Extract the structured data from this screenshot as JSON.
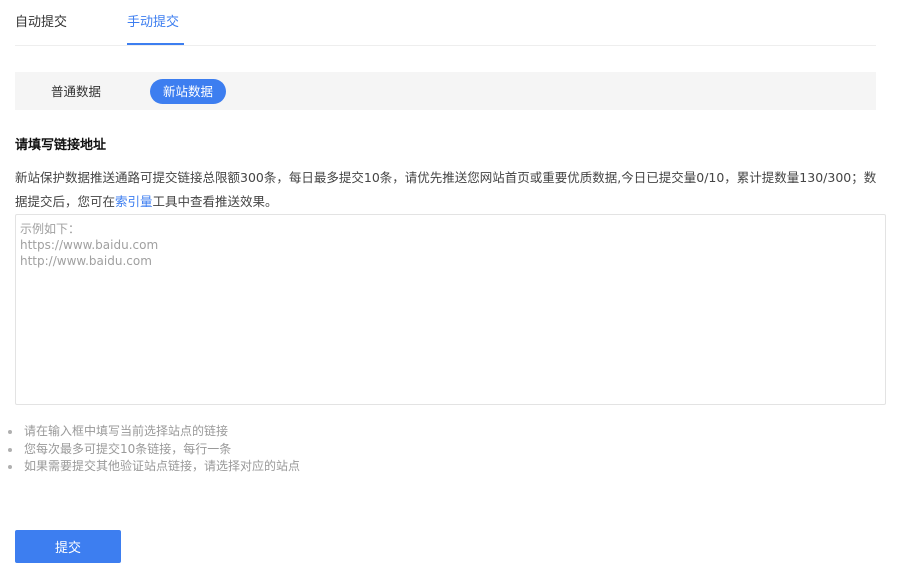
{
  "tabs": {
    "auto_submit": "自动提交",
    "manual_submit": "手动提交"
  },
  "data_type": {
    "normal": "普通数据",
    "new_site": "新站数据"
  },
  "form": {
    "title": "请填写链接地址",
    "desc_before_link": "新站保护数据推送通路可提交链接总限额300条，每日最多提交10条，请优先推送您网站首页或重要优质数据,今日已提交量0/10，累计提数量130/300；数据提交后，您可在",
    "desc_link": "索引量",
    "desc_after_link": "工具中查看推送效果。",
    "placeholder": "示例如下：\nhttps://www.baidu.com\nhttp://www.baidu.com",
    "value": ""
  },
  "tips": [
    "请在输入框中填写当前选择站点的链接",
    "您每次最多可提交10条链接，每行一条",
    "如果需要提交其他验证站点链接，请选择对应的站点"
  ],
  "actions": {
    "submit_label": "提交"
  },
  "colors": {
    "accent": "#3d7ef0",
    "sub_bar_bg": "#f5f5f5",
    "tip_text": "#999999"
  }
}
